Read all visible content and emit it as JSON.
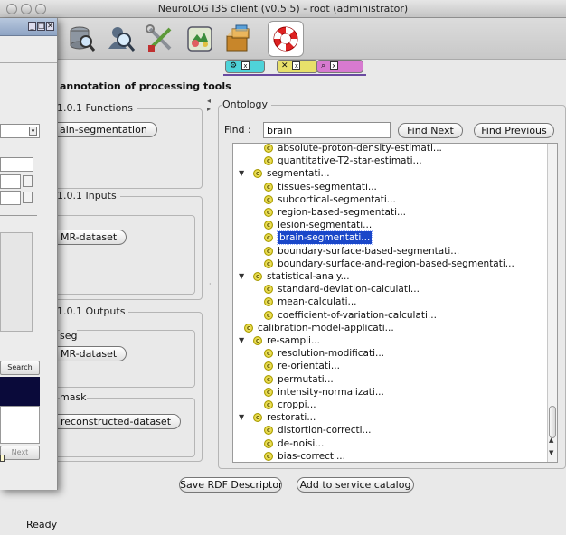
{
  "window": {
    "title": "NeuroLOG I3S client (v0.5.5) - root (administrator)"
  },
  "toolbar": {
    "tools": [
      {
        "icon": "database-search-icon"
      },
      {
        "icon": "user-search-icon"
      },
      {
        "icon": "tools-icon"
      },
      {
        "icon": "puzzle-icon"
      },
      {
        "icon": "boxes-icon"
      },
      {
        "icon": "lifebuoy-icon"
      }
    ]
  },
  "tool_strip": {
    "chips": [
      {
        "x": "x",
        "color": "#4fd3d9"
      },
      {
        "x": "x",
        "color": "#e8e06a"
      },
      {
        "x": "x",
        "color": "#d77ad0"
      }
    ]
  },
  "page": {
    "heading": "annotation of processing tools"
  },
  "functions": {
    "legend": "1.0.1 Functions",
    "button": "ain-segmentation"
  },
  "inputs": {
    "legend": "1.0.1 Inputs",
    "button": "MR-dataset"
  },
  "outputs": {
    "legend": "1.0.1 Outputs",
    "seg_label": "seg",
    "seg_button": "MR-dataset",
    "mask_label": "mask",
    "mask_button": "reconstructed-dataset"
  },
  "ontology": {
    "legend": "Ontology",
    "find_label": "Find :",
    "find_value": "brain",
    "find_next": "Find Next",
    "find_previous": "Find Previous",
    "tree": [
      {
        "label": "absolute-proton-density-estimati...",
        "level": 2,
        "expanded": null,
        "selected": false
      },
      {
        "label": "quantitative-T2-star-estimati...",
        "level": 2,
        "expanded": null,
        "selected": false
      },
      {
        "label": "segmentati...",
        "level": 1,
        "expanded": true,
        "selected": false
      },
      {
        "label": "tissues-segmentati...",
        "level": 2,
        "expanded": null,
        "selected": false
      },
      {
        "label": "subcortical-segmentati...",
        "level": 2,
        "expanded": null,
        "selected": false
      },
      {
        "label": "region-based-segmentati...",
        "level": 2,
        "expanded": null,
        "selected": false
      },
      {
        "label": "lesion-segmentati...",
        "level": 2,
        "expanded": null,
        "selected": false
      },
      {
        "label": "brain-segmentati...",
        "level": 2,
        "expanded": null,
        "selected": true
      },
      {
        "label": "boundary-surface-based-segmentati...",
        "level": 2,
        "expanded": null,
        "selected": false
      },
      {
        "label": "boundary-surface-and-region-based-segmentati...",
        "level": 2,
        "expanded": null,
        "selected": false
      },
      {
        "label": "statistical-analy...",
        "level": 1,
        "expanded": true,
        "selected": false
      },
      {
        "label": "standard-deviation-calculati...",
        "level": 2,
        "expanded": null,
        "selected": false
      },
      {
        "label": "mean-calculati...",
        "level": 2,
        "expanded": null,
        "selected": false
      },
      {
        "label": "coefficient-of-variation-calculati...",
        "level": 2,
        "expanded": null,
        "selected": false
      },
      {
        "label": "calibration-model-applicati...",
        "level": 1,
        "expanded": null,
        "selected": false
      },
      {
        "label": "re-sampli...",
        "level": 1,
        "expanded": true,
        "selected": false
      },
      {
        "label": "resolution-modificati...",
        "level": 2,
        "expanded": null,
        "selected": false
      },
      {
        "label": "re-orientati...",
        "level": 2,
        "expanded": null,
        "selected": false
      },
      {
        "label": "permutati...",
        "level": 2,
        "expanded": null,
        "selected": false
      },
      {
        "label": "intensity-normalizati...",
        "level": 2,
        "expanded": null,
        "selected": false
      },
      {
        "label": "croppi...",
        "level": 2,
        "expanded": null,
        "selected": false
      },
      {
        "label": "restorati...",
        "level": 1,
        "expanded": true,
        "selected": false
      },
      {
        "label": "distortion-correcti...",
        "level": 2,
        "expanded": null,
        "selected": false
      },
      {
        "label": "de-noisi...",
        "level": 2,
        "expanded": null,
        "selected": false
      },
      {
        "label": "bias-correcti...",
        "level": 2,
        "expanded": null,
        "selected": false
      }
    ]
  },
  "actions": {
    "save_rdf": "Save RDF Descriptor",
    "add_catalog": "Add to service catalog"
  },
  "status": {
    "text": "Ready"
  },
  "dialog": {
    "search_button": "Search",
    "next_button": "Next"
  },
  "colors": {
    "selection": "#1a47c9",
    "dialog_list_bg": "#0a0a3a"
  }
}
